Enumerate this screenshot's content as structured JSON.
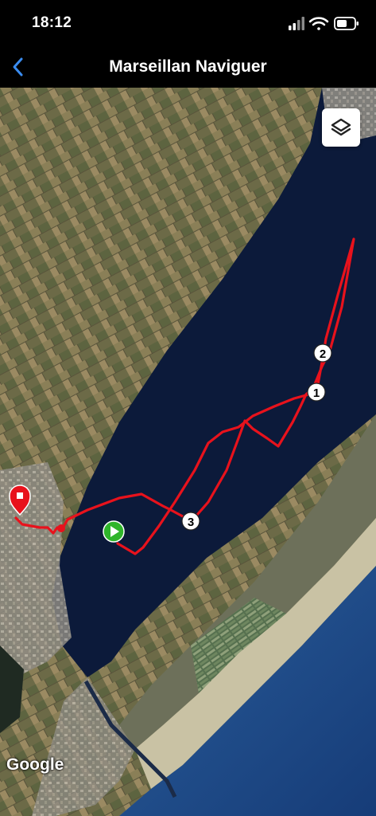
{
  "status_bar": {
    "time": "18:12"
  },
  "nav": {
    "title": "Marseillan Naviguer",
    "back_icon": "chevron-left-icon"
  },
  "map": {
    "type": "satellite",
    "layers_icon": "layers-icon",
    "attribution": "Google",
    "colors": {
      "track": "#e8121c",
      "start": "#2fb52a",
      "end": "#e8121c",
      "water": "#0c1a3a",
      "sea": "#1e4a88",
      "land": "#6b6a48"
    },
    "waypoints": [
      {
        "label": "1"
      },
      {
        "label": "2"
      },
      {
        "label": "3"
      }
    ],
    "start_marker_icon": "play-icon",
    "end_marker_icon": "stop-icon"
  }
}
